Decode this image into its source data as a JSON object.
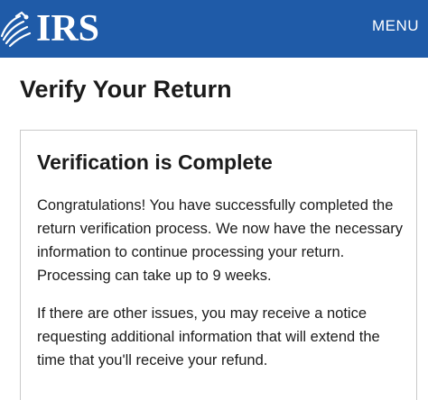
{
  "header": {
    "logo_text": "IRS",
    "logo_icon": "eagle-emblem-icon",
    "menu_label": "MENU",
    "background_color": "#1f5ba8"
  },
  "page": {
    "title": "Verify Your Return"
  },
  "card": {
    "title": "Verification is Complete",
    "paragraph1": "Congratulations! You have successfully completed the return verification process. We now have the necessary information to continue processing your return. Processing can take up to 9 weeks.",
    "paragraph2": "If there are other issues, you may receive a notice requesting additional information that will extend the time that you'll receive your refund."
  }
}
